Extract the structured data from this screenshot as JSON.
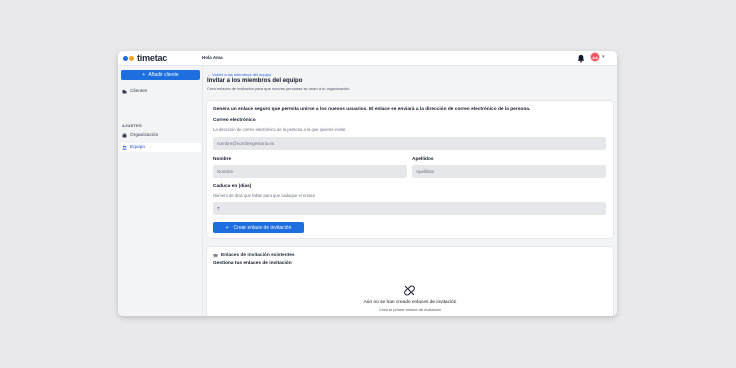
{
  "brand": {
    "name": "timetac",
    "dot_colors": [
      "#1d6fe0",
      "#f5a524"
    ],
    "accent": "#1d6fe0"
  },
  "topbar": {
    "greeting": "Hola Ama",
    "avatar_initials": "AA",
    "avatar_color": "#e9525e"
  },
  "sidebar": {
    "add_button": "Añadir cliente",
    "items": [
      {
        "label": "Clientes",
        "icon": "building-icon"
      }
    ],
    "section_label": "AJUSTES",
    "settings_items": [
      {
        "label": "Organización",
        "icon": "briefcase-icon"
      },
      {
        "label": "Equipo",
        "icon": "users-icon",
        "active": true
      }
    ]
  },
  "main": {
    "back_link": "Volver a los miembros del equipo",
    "title": "Invitar a los miembros del equipo",
    "subtitle": "Crea enlaces de invitación para que nuevas personas se unan a tu organización."
  },
  "form": {
    "intro": "Genera un enlace seguro que permita unirse a los nuevos usuarios. El enlace se enviará a la dirección de correo electrónico de la persona.",
    "email": {
      "label": "Correo electrónico",
      "hint": "La dirección de correo electrónico de la persona a la que quieres invitar",
      "placeholder": "nombre@nombregestoria.es"
    },
    "first_name": {
      "label": "Nombre",
      "placeholder": "Nombre"
    },
    "last_name": {
      "label": "Apellidos",
      "placeholder": "Apellidos"
    },
    "expires": {
      "label": "Caduca en (días)",
      "hint": "Número de días que faltan para que caduque el enlace",
      "value": "7"
    },
    "submit": "Crear enlace de invitación"
  },
  "existing": {
    "title": "Enlaces de invitación existentes",
    "subtitle": "Gestiona tus enlaces de invitación",
    "empty_title": "Aún no se han creado enlaces de invitación",
    "empty_sub": "Crea tu primer enlace de invitación"
  }
}
